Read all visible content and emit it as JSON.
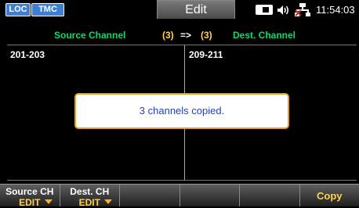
{
  "status": {
    "loc": "LOC",
    "tmc": "TMC",
    "mode": "Edit",
    "time": "11:54:03",
    "icons": [
      "battery-icon",
      "speaker-icon",
      "lan-icon"
    ]
  },
  "channels": {
    "source_label": "Source Channel",
    "source_count": "(3)",
    "arrow": "=>",
    "dest_count": "(3)",
    "dest_label": "Dest. Channel",
    "source_range": "201-203",
    "dest_range": "209-211"
  },
  "dialog": {
    "message": "3 channels copied."
  },
  "softkeys": [
    {
      "line1": "Source CH",
      "line2": "EDIT"
    },
    {
      "line1": "Dest. CH",
      "line2": "EDIT"
    },
    {
      "label": ""
    },
    {
      "label": ""
    },
    {
      "label": ""
    },
    {
      "label": "Copy"
    }
  ],
  "colors": {
    "label_green": "#00e070",
    "value_yellow": "#ffd24a",
    "badge_blue": "#3b7fd6",
    "dialog_text": "#1a3fd6",
    "dialog_border": "#e8a020"
  }
}
